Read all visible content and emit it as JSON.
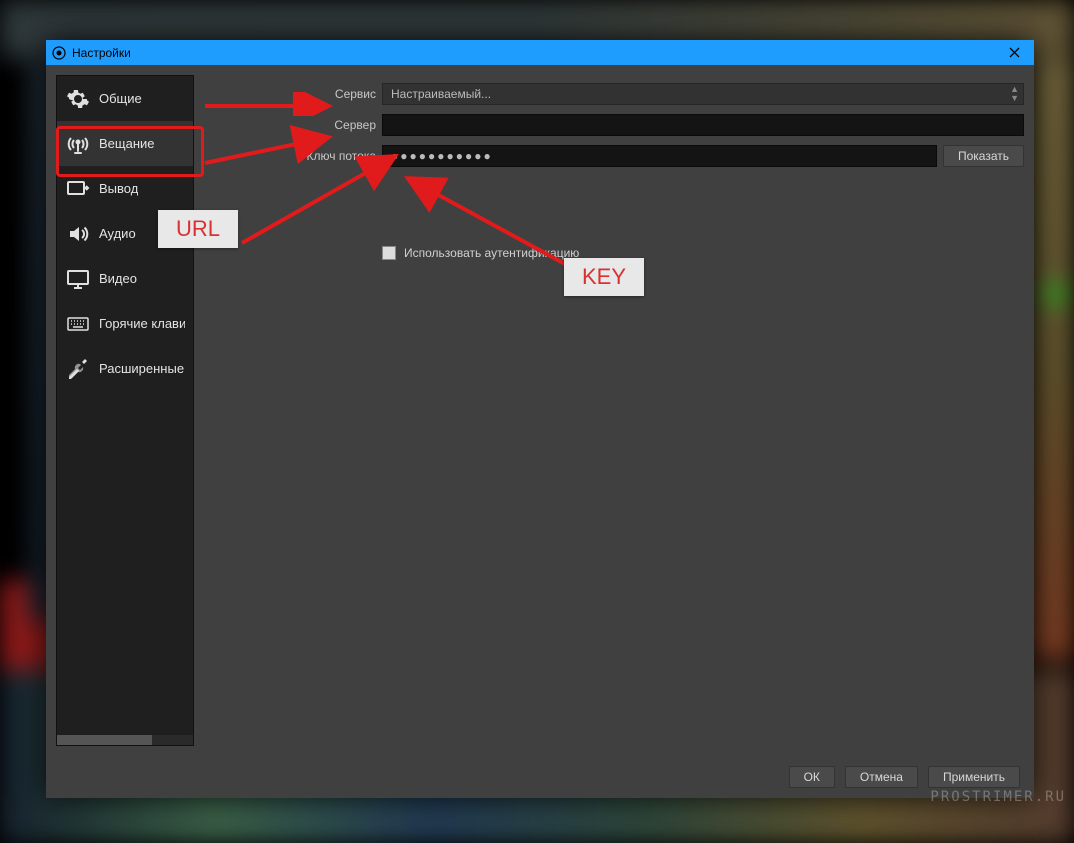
{
  "window": {
    "title": "Настройки"
  },
  "sidebar": {
    "items": [
      {
        "label": "Общие",
        "icon": "gear-icon"
      },
      {
        "label": "Вещание",
        "icon": "antenna-icon",
        "active": true
      },
      {
        "label": "Вывод",
        "icon": "output-icon"
      },
      {
        "label": "Аудио",
        "icon": "speaker-icon"
      },
      {
        "label": "Видео",
        "icon": "monitor-icon"
      },
      {
        "label": "Горячие клавиши",
        "icon": "keyboard-icon"
      },
      {
        "label": "Расширенные",
        "icon": "tools-icon"
      }
    ]
  },
  "form": {
    "service_label": "Сервис",
    "service_value": "Настраиваемый...",
    "server_label": "Сервер",
    "server_value": "",
    "key_label": "Ключ потока",
    "key_value": "●●●●●●●●●●●",
    "show_button": "Показать",
    "auth_label": "Использовать аутентификацию"
  },
  "footer": {
    "ok": "ОК",
    "cancel": "Отмена",
    "apply": "Применить"
  },
  "annotations": {
    "url_tag": "URL",
    "key_tag": "KEY"
  },
  "watermark": "PROSTRIMER.RU"
}
